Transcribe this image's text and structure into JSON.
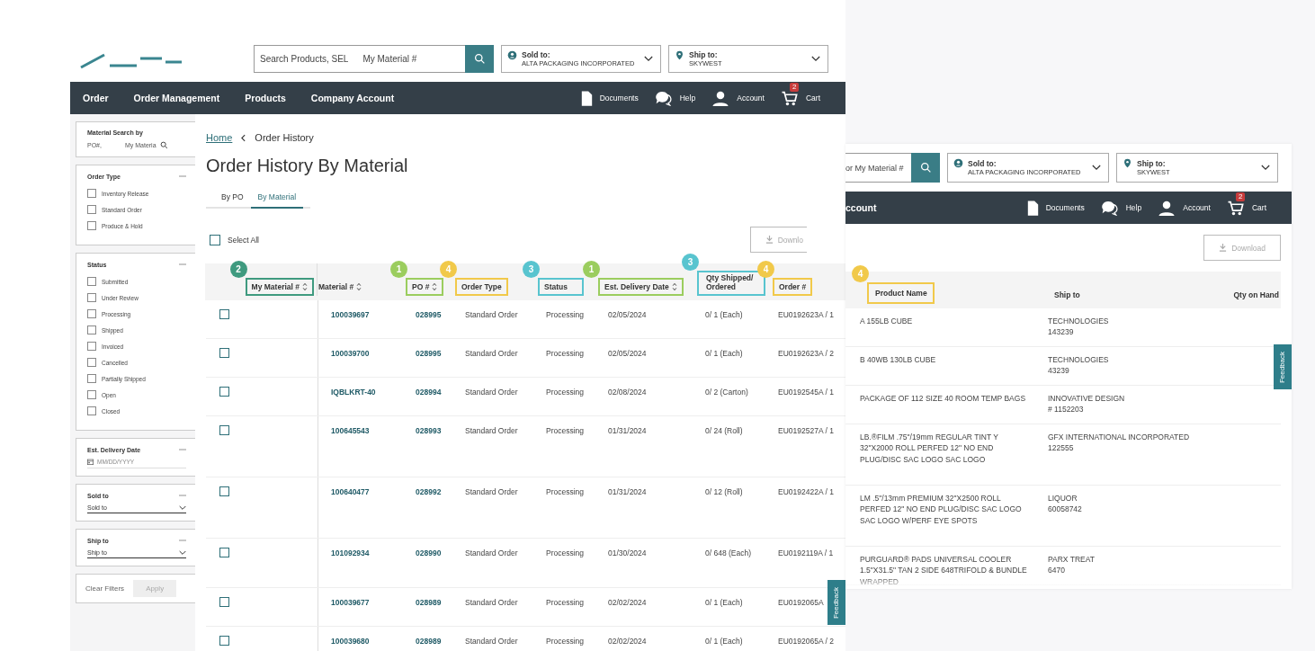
{
  "left": {
    "header": {
      "search": {
        "texts": [
          "Search Products, SEL",
          "My Material #"
        ]
      },
      "sold_to": {
        "label": "Sold to:",
        "value": "ALTA PACKAGING INCORPORATED"
      },
      "ship_to": {
        "label": "Ship to:",
        "value": "SKYWEST"
      }
    },
    "nav": {
      "items": [
        "Order",
        "Order Management",
        "Products",
        "Company Account"
      ],
      "tools": [
        {
          "kind": "documents",
          "label": "Documents"
        },
        {
          "kind": "help",
          "label": "Help"
        },
        {
          "kind": "account",
          "label": "Account"
        },
        {
          "kind": "cart",
          "label": "Cart",
          "badge": "2"
        }
      ]
    },
    "sidebar": {
      "sections": [
        {
          "kind": "search",
          "title": "Material Search by",
          "texts": [
            "PO#,",
            "My Materia"
          ]
        },
        {
          "kind": "checks",
          "title": "Order Type",
          "expanded": true,
          "options": [
            {
              "label": "Inventory Release",
              "checked": false
            },
            {
              "label": "Standard Order",
              "checked": false
            },
            {
              "label": "Produce & Hold",
              "checked": false
            }
          ]
        },
        {
          "kind": "checks",
          "title": "Status",
          "expanded": true,
          "options": [
            {
              "label": "Submitted",
              "checked": false
            },
            {
              "label": "Under Review",
              "checked": false
            },
            {
              "label": "Processing",
              "checked": false
            },
            {
              "label": "Shipped",
              "checked": false
            },
            {
              "label": "Invoiced",
              "checked": false
            },
            {
              "label": "Cancelled",
              "checked": false
            },
            {
              "label": "Partially Shipped",
              "checked": false
            },
            {
              "label": "Open",
              "checked": false
            },
            {
              "label": "Closed",
              "checked": false
            }
          ]
        },
        {
          "kind": "date",
          "title": "Est. Delivery Date",
          "expanded": true,
          "placeholder": "MM/DD/YYYY"
        },
        {
          "kind": "select",
          "title": "Sold to",
          "expanded": true,
          "value": "Sold to"
        },
        {
          "kind": "select",
          "title": "Ship to",
          "expanded": true,
          "value": "Ship to"
        }
      ],
      "clear": "Clear Filters",
      "apply": {
        "label": "Apply",
        "disabled": true
      }
    },
    "breadcrumb": [
      {
        "label": "Home",
        "link": true
      },
      {
        "label": "Order History",
        "link": false
      }
    ],
    "title": "Order History By Material",
    "tabs": [
      {
        "label": "By PO",
        "selected": false
      },
      {
        "label": "By Material",
        "selected": true
      }
    ],
    "select_all": {
      "label": "Select All",
      "checked": false
    },
    "download": {
      "label": "Downlo",
      "disabled": true
    },
    "table": {
      "columns": [
        {
          "label": "My Material #",
          "sortable": true,
          "badge": {
            "number": "2",
            "color": "#3f9a7f"
          }
        },
        {
          "label": "Material #",
          "sortable": true
        },
        {
          "label": "PO #",
          "sortable": true,
          "badge": {
            "number": "1",
            "color": "#9bcd5e"
          }
        },
        {
          "label": "Order Type",
          "sortable": false,
          "badge": {
            "number": "4",
            "color": "#f1c94a"
          }
        },
        {
          "label": "Status",
          "sortable": false,
          "badge": {
            "number": "3",
            "color": "#58c4cf"
          }
        },
        {
          "label": "Est. Delivery Date",
          "sortable": true,
          "badge": {
            "number": "1",
            "color": "#9bcd5e"
          }
        },
        {
          "label": "Qty Shipped/ Ordered",
          "sortable": false,
          "badge": {
            "number": "3",
            "color": "#58c4cf"
          }
        },
        {
          "label": "Order #",
          "sortable": false,
          "badge": {
            "number": "4",
            "color": "#f1c94a"
          }
        }
      ],
      "rows": [
        {
          "checked": false,
          "cells": [
            "",
            "100039697",
            "028995",
            "Standard Order",
            "Processing",
            "02/05/2024",
            "0/ 1 (Each)",
            "EU0192623A / 1"
          ]
        },
        {
          "checked": false,
          "cells": [
            "",
            "100039700",
            "028995",
            "Standard Order",
            "Processing",
            "02/05/2024",
            "0/ 1 (Each)",
            "EU0192623A / 2"
          ]
        },
        {
          "checked": false,
          "cells": [
            "",
            "IQBLKRT-40",
            "028994",
            "Standard Order",
            "Processing",
            "02/08/2024",
            "0/ 2 (Carton)",
            "EU0192545A / 1"
          ]
        },
        {
          "checked": false,
          "cells": [
            "",
            "100645543",
            "028993",
            "Standard Order",
            "Processing",
            "01/31/2024",
            "0/ 24 (Roll)",
            "EU0192527A / 1"
          ]
        },
        {
          "checked": false,
          "cells": [
            "",
            "100640477",
            "028992",
            "Standard Order",
            "Processing",
            "01/31/2024",
            "0/ 12 (Roll)",
            "EU0192422A / 1"
          ]
        },
        {
          "checked": false,
          "cells": [
            "",
            "101092934",
            "028990",
            "Standard Order",
            "Processing",
            "01/30/2024",
            "0/ 648 (Each)",
            "EU0192119A / 1"
          ]
        },
        {
          "checked": false,
          "cells": [
            "",
            "100039677",
            "028989",
            "Standard Order",
            "Processing",
            "02/02/2024",
            "0/ 1 (Each)",
            "EU0192065A"
          ]
        },
        {
          "checked": false,
          "cells": [
            "",
            "100039680",
            "028989",
            "Standard Order",
            "Processing",
            "02/02/2024",
            "0/ 1 (Each)",
            "EU0192065A / 2"
          ]
        }
      ]
    },
    "feedback": "Feedback"
  },
  "right": {
    "header": {
      "search": {
        "text": "or My Material #"
      },
      "sold_to": {
        "label": "Sold to:",
        "value": "ALTA PACKAGING INCORPORATED"
      },
      "ship_to": {
        "label": "Ship to:",
        "value": "SKYWEST"
      }
    },
    "nav": {
      "partial": "ccount",
      "tools": [
        {
          "kind": "documents",
          "label": "Documents"
        },
        {
          "kind": "help",
          "label": "Help"
        },
        {
          "kind": "account",
          "label": "Account"
        },
        {
          "kind": "cart",
          "label": "Cart",
          "badge": "2"
        }
      ]
    },
    "download": {
      "label": "Download",
      "disabled": true
    },
    "table": {
      "columns": [
        {
          "label": "Product Name",
          "badge": {
            "number": "4",
            "color": "#f1c94a"
          }
        },
        {
          "label": "Ship to"
        },
        {
          "label": "Qty on Hand"
        }
      ],
      "rows": [
        {
          "product": "A 155LB CUBE",
          "ship_to": [
            "TECHNOLOGIES",
            "143239"
          ]
        },
        {
          "product": "B 40WB 130LB CUBE",
          "ship_to": [
            "TECHNOLOGIES",
            "43239"
          ]
        },
        {
          "product": "PACKAGE OF 112 SIZE 40 ROOM TEMP BAGS",
          "ship_to": [
            "INNOVATIVE DESIGN",
            "# 1152203"
          ]
        },
        {
          "product": "LB.®FILM .75\"/19mm REGULAR TINT Y 32\"X2000 ROLL PERFED 12\" NO END PLUG/DISC SAC LOGO SAC LOGO",
          "ship_to": [
            "GFX INTERNATIONAL INCORPORATED",
            "122555"
          ]
        },
        {
          "product": "LM .5\"/13mm PREMIUM 32\"X2500 ROLL PERFED 12\" NO END PLUG/DISC SAC LOGO SAC LOGO W/PERF EYE SPOTS",
          "ship_to": [
            "LIQUOR",
            "60058742"
          ]
        },
        {
          "product": "PURGUARD® PADS UNIVERSAL COOLER 1.5\"X31.5\" TAN 2 SIDE 648TRIFOLD & BUNDLE WRAPPED",
          "ship_to": [
            "PARX TREAT",
            "6470"
          ]
        }
      ]
    },
    "feedback": "Feedback"
  }
}
